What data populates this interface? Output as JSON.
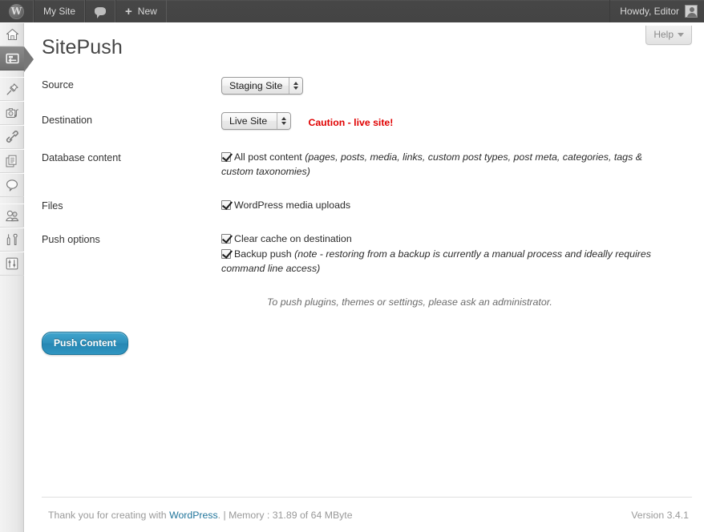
{
  "adminbar": {
    "logo_icon": "wordpress-logo-icon",
    "site_name": "My Site",
    "comments_icon": "comment-bubble-icon",
    "new_label": "New",
    "new_icon": "plus-icon",
    "greeting": "Howdy, Editor",
    "avatar_icon": "avatar-icon"
  },
  "sidebar": {
    "items": [
      {
        "name": "dashboard",
        "icon": "home-icon",
        "current": false
      },
      {
        "name": "sitepush",
        "icon": "push-arrows-icon",
        "current": true
      },
      {
        "name": "posts",
        "icon": "pushpin-icon",
        "current": false
      },
      {
        "name": "media",
        "icon": "camera-icon",
        "current": false
      },
      {
        "name": "links",
        "icon": "chain-link-icon",
        "current": false
      },
      {
        "name": "pages",
        "icon": "pages-document-icon",
        "current": false
      },
      {
        "name": "comments",
        "icon": "speech-bubble-icon",
        "current": false
      },
      {
        "name": "users",
        "icon": "users-icon",
        "current": false
      },
      {
        "name": "tools",
        "icon": "tools-icon",
        "current": false
      },
      {
        "name": "settings",
        "icon": "settings-sliders-icon",
        "current": false
      }
    ]
  },
  "help": {
    "label": "Help",
    "caret_icon": "chevron-down-icon"
  },
  "page": {
    "title": "SitePush"
  },
  "form": {
    "source": {
      "label": "Source",
      "value": "Staging Site"
    },
    "destination": {
      "label": "Destination",
      "value": "Live Site",
      "caution": "Caution - live site!"
    },
    "database": {
      "label": "Database content",
      "option_label": "All post content",
      "option_hint": "(pages, posts, media, links, custom post types, post meta, categories, tags & custom taxonomies)",
      "checked": true
    },
    "files": {
      "label": "Files",
      "option_label": "WordPress media uploads",
      "checked": true
    },
    "push_options": {
      "label": "Push options",
      "options": [
        {
          "label": "Clear cache on destination",
          "hint": "",
          "checked": true
        },
        {
          "label": "Backup push ",
          "hint": "(note - restoring from a backup is currently a manual process and ideally requires command line access)",
          "checked": true
        }
      ]
    },
    "admin_note": "To push plugins, themes or settings, please ask an administrator.",
    "submit_label": "Push Content"
  },
  "footer": {
    "thanks_prefix": "Thank you for creating with ",
    "wordpress_link": "WordPress",
    "memory_text": ". | Memory : 31.89 of 64 MByte",
    "version": "Version 3.4.1"
  },
  "colors": {
    "adminbar_bg": "#464646",
    "accent_blue": "#21759b",
    "button_blue": "#2e90bb",
    "caution_red": "#e00000",
    "sidebar_bg": "#ececec",
    "current_menu": "#777777"
  }
}
